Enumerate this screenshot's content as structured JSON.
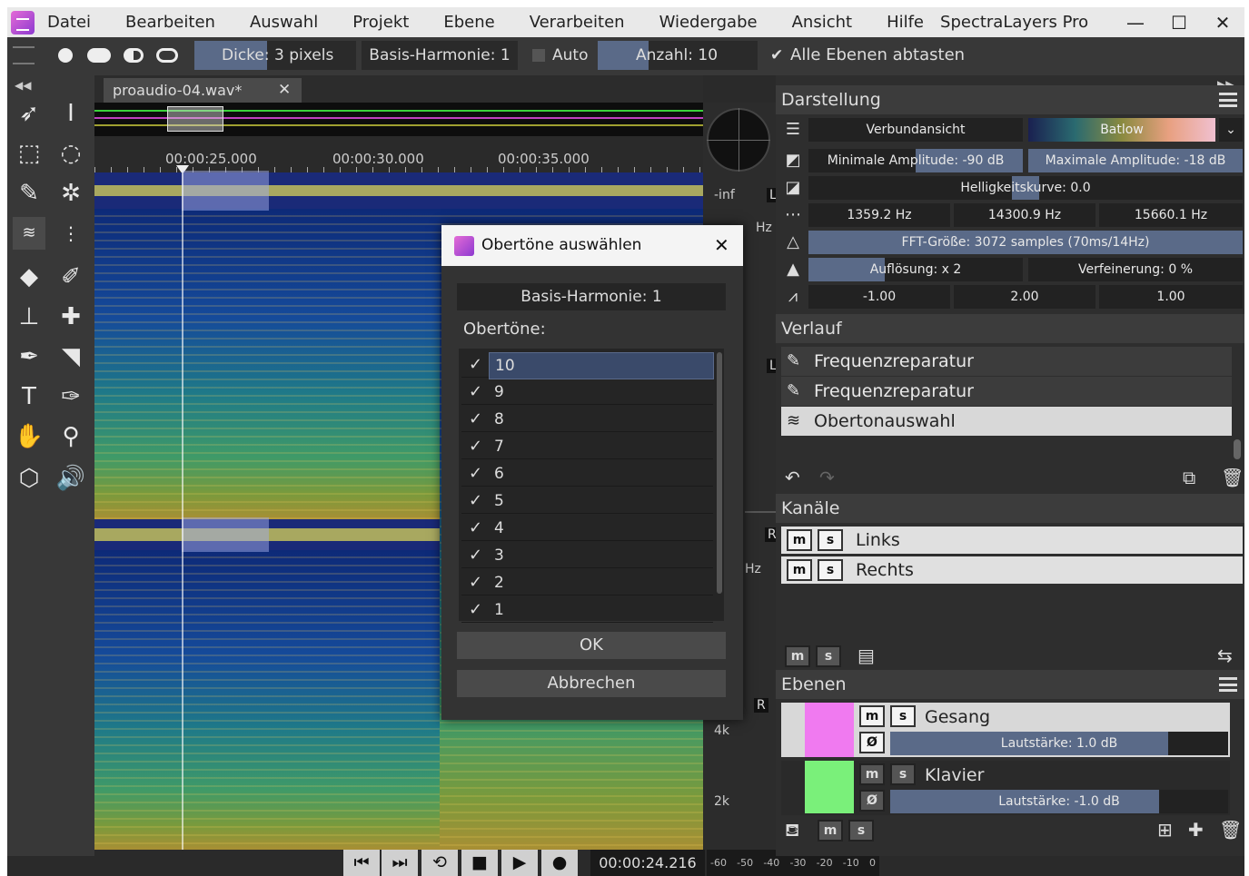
{
  "menubar": {
    "items": [
      "Datei",
      "Bearbeiten",
      "Auswahl",
      "Projekt",
      "Ebene",
      "Verarbeiten",
      "Wiedergabe",
      "Ansicht",
      "Hilfe"
    ],
    "app_title": "SpectraLayers Pro",
    "minimize": "—",
    "maximize": "☐",
    "close": "✕"
  },
  "toolbar": {
    "thickness": "Dicke: 3 pixels",
    "thickness_level": 0.45,
    "basis": "Basis-Harmonie: 1",
    "auto": "Auto",
    "count": "Anzahl: 10",
    "sample_all": "Alle Ebenen abtasten",
    "check": "✔"
  },
  "tab": {
    "name": "proaudio-04.wav*",
    "close": "✕"
  },
  "ruler": {
    "ticks": [
      "00:00:25.000",
      "00:00:30.000",
      "00:00:35.000"
    ]
  },
  "strip": {
    "inf": "-inf",
    "L1": "L",
    "L2": "L",
    "R1": "R",
    "R2": "R",
    "hz1": "Hz",
    "hz2": "Hz",
    "k4": "4k",
    "k2": "2k"
  },
  "transport": {
    "time": "00:00:24.216",
    "meter": [
      "-60",
      "-50",
      "-40",
      "-30",
      "-20",
      "-10",
      "0"
    ],
    "icons": {
      "prev": "⏮",
      "next": "⏭",
      "loop": "⟲",
      "stop": "■",
      "play": "▶",
      "record": "●"
    }
  },
  "darstellung": {
    "title": "Darstellung",
    "view": "Verbundansicht",
    "colormap": "Batlow",
    "min_amp": "Minimale Amplitude: -90 dB",
    "max_amp": "Maximale Amplitude: -18 dB",
    "brightness": "Helligkeitskurve: 0.0",
    "freq": [
      "1359.2  Hz",
      "14300.9  Hz",
      "15660.1  Hz"
    ],
    "fft": "FFT-Größe: 3072 samples (70ms/14Hz)",
    "resolution": "Auflösung: x 2",
    "refinement": "Verfeinerung: 0 %",
    "values": [
      "-1.00",
      "2.00",
      "1.00"
    ]
  },
  "verlauf": {
    "title": "Verlauf",
    "items": [
      "Frequenzreparatur",
      "Frequenzreparatur",
      "Obertonauswahl"
    ]
  },
  "kanaele": {
    "title": "Kanäle",
    "items": [
      "Links",
      "Rechts"
    ],
    "m": "m",
    "s": "s"
  },
  "ebenen": {
    "title": "Ebenen",
    "layers": [
      {
        "name": "Gesang",
        "volume": "Lautstärke: 1.0 dB",
        "color": "#f07af0"
      },
      {
        "name": "Klavier",
        "volume": "Lautstärke: -1.0 dB",
        "color": "#7af07a"
      }
    ],
    "phase": "Ø"
  },
  "dialog": {
    "title": "Obertöne auswählen",
    "close": "✕",
    "basis": "Basis-Harmonie: 1",
    "label": "Obertöne:",
    "items": [
      "10",
      "9",
      "8",
      "7",
      "6",
      "5",
      "4",
      "3",
      "2",
      "1"
    ],
    "ok": "OK",
    "cancel": "Abbrechen",
    "check": "✓"
  }
}
